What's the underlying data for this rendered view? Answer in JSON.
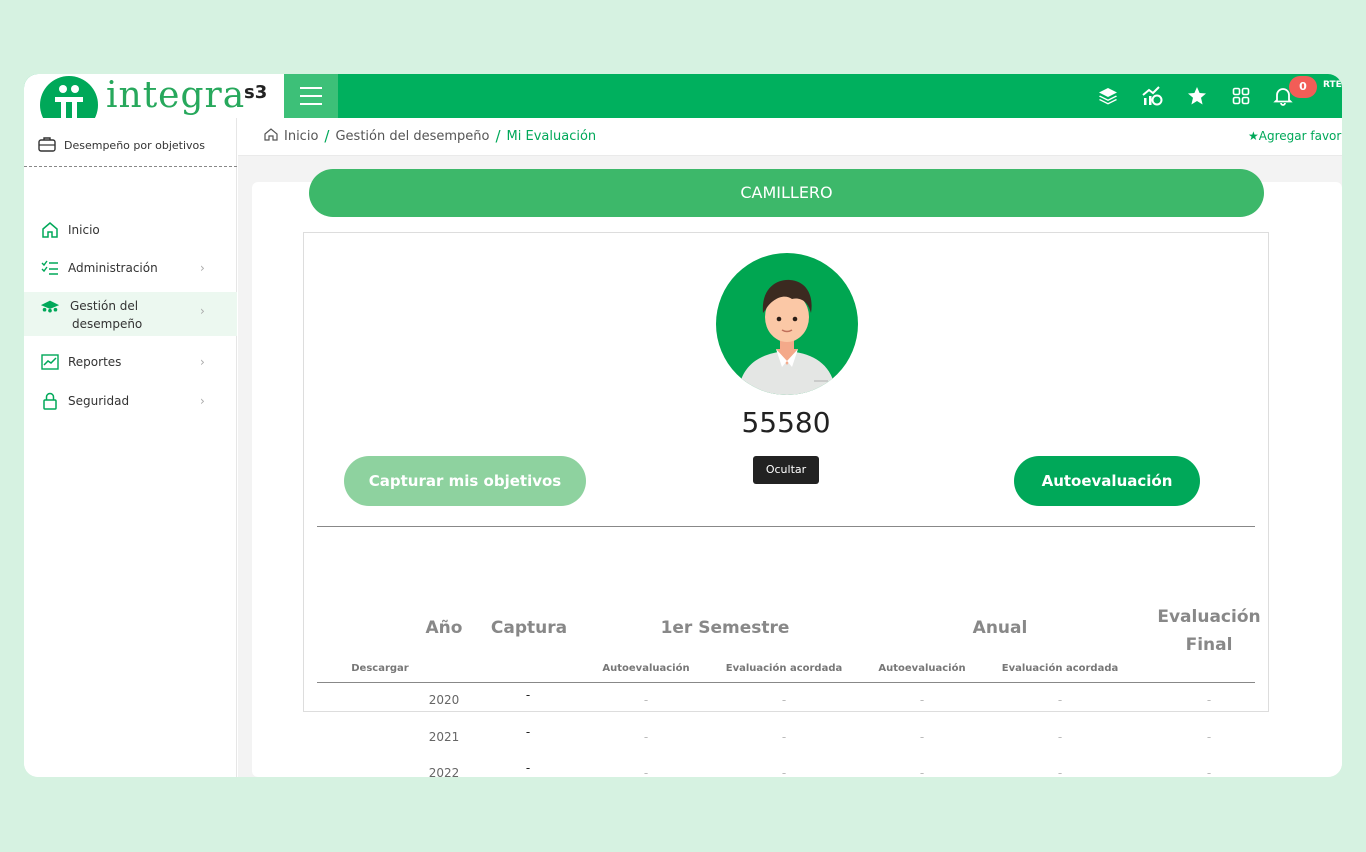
{
  "brand": {
    "logo_text": "integra",
    "logo_suffix": "s3"
  },
  "topbar": {
    "icons": [
      "layers-icon",
      "growth-chart-icon",
      "star-icon",
      "grid-icon",
      "bell-icon"
    ],
    "notifications_count": "0",
    "user_initials": "RTE"
  },
  "sidebar": {
    "module": "Desempeño por objetivos",
    "items": [
      {
        "label": "Inicio",
        "icon": "home-icon"
      },
      {
        "label": "Administración",
        "icon": "checklist-icon"
      },
      {
        "label": "Gestión del desempeño",
        "icon": "team-icon",
        "active": true
      },
      {
        "label": "Reportes",
        "icon": "chart-icon"
      },
      {
        "label": "Seguridad",
        "icon": "lock-icon"
      }
    ]
  },
  "breadcrumb": {
    "home": "Inicio",
    "section": "Gestión del desempeño",
    "current": "Mi Evaluación",
    "favorite": "Agregar favor"
  },
  "profile": {
    "role": "CAMILLERO",
    "employee_id": "55580",
    "hide_label": "Ocultar",
    "capture_label": "Capturar mis objetivos",
    "self_eval_label": "Autoevaluación"
  },
  "table": {
    "headers": {
      "year": "Año",
      "capture": "Captura",
      "semester": "1er Semestre",
      "annual": "Anual",
      "final": "Evaluación Final",
      "download": "Descargar",
      "self_eval": "Autoevaluación",
      "agreed_eval": "Evaluación acordada"
    },
    "rows": [
      {
        "year": "2020",
        "capture": "-",
        "s_auto": "-",
        "s_agreed": "-",
        "a_auto": "-",
        "a_agreed": "-",
        "final": "-"
      },
      {
        "year": "2021",
        "capture": "-",
        "s_auto": "-",
        "s_agreed": "-",
        "a_auto": "-",
        "a_agreed": "-",
        "final": "-"
      },
      {
        "year": "2022",
        "capture": "-",
        "s_auto": "-",
        "s_agreed": "-",
        "a_auto": "-",
        "a_agreed": "-",
        "final": "-"
      }
    ]
  },
  "colors": {
    "primary": "#00b05e",
    "accent": "#3db86a",
    "background": "#d6f2e1"
  }
}
